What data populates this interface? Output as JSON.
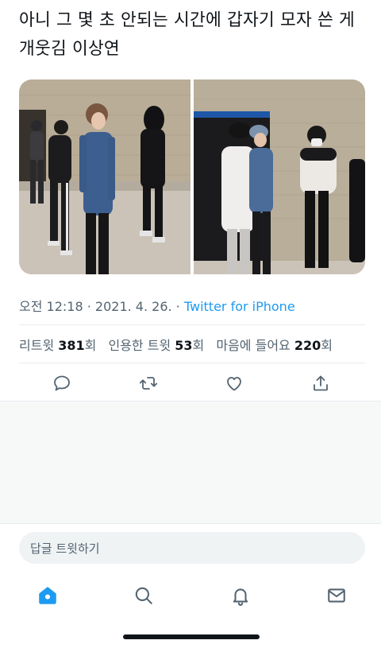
{
  "tweet": {
    "text": "아니 그 몇 초 안되는 시간에 갑자기 모자 쓴 게 개웃김 이상연"
  },
  "meta": {
    "time": "오전 12:18",
    "separator1": " · ",
    "date": "2021. 4. 26.",
    "separator2": " · ",
    "source": "Twitter for iPhone"
  },
  "stats": {
    "retweets_label": "리트윗 ",
    "retweets_count": "381",
    "retweets_unit": "회",
    "quotes_label": "인용한 트윗 ",
    "quotes_count": "53",
    "quotes_unit": "회",
    "likes_label": "마음에 들어요 ",
    "likes_count": "220",
    "likes_unit": "회"
  },
  "actions": [
    "reply-icon",
    "retweet-icon",
    "like-icon",
    "share-icon"
  ],
  "reply": {
    "placeholder": "답글 트윗하기"
  },
  "tabbar": {
    "items": [
      "home-icon",
      "search-icon",
      "notifications-icon",
      "messages-icon"
    ],
    "active_color": "#1d9bf0",
    "inactive_color": "#536471"
  },
  "colors": {
    "link": "#1d9bf0",
    "secondary_text": "#536471",
    "primary_text": "#0f1419"
  }
}
